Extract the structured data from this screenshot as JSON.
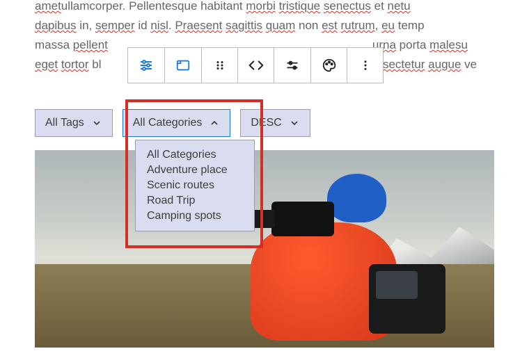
{
  "paragraph": {
    "line1a": "amet",
    "line1b": "ullamcorper",
    "line1c": ". Pellentesque habitant ",
    "line1d": "morbi",
    "line1e": " ",
    "line1f": "tristique",
    "line1g": " ",
    "line1h": "senectus",
    "line1i": " et ",
    "line1j": "netu",
    "line2a": "dapibus",
    "line2b": " in, ",
    "line2c": "semper",
    "line2d": " id ",
    "line2e": "nisl",
    "line2f": ". ",
    "line2g": "Praesent",
    "line2h": " ",
    "line2i": "sagittis",
    "line2j": " ",
    "line2k": "quam",
    "line2l": " non ",
    "line2m": "est",
    "line2n": " ",
    "line2o": "rutrum",
    "line2p": ", ",
    "line2q": "eu",
    "line2r": " temp",
    "line3a": "massa ",
    "line3b": "pellent",
    "line3c": "urna",
    "line3d": " porta ",
    "line3e": "malesu",
    "line4a": "eget",
    "line4b": " ",
    "line4c": "tortor",
    "line4d": " bl",
    "line4e": "nsectetur",
    "line4f": " ",
    "line4g": "augue",
    "line4h": " ve"
  },
  "filters": {
    "tags": {
      "label": "All Tags"
    },
    "categories": {
      "label": "All Categories",
      "options": [
        "All Categories",
        "Adventure place",
        "Scenic routes",
        "Road Trip",
        "Camping spots"
      ]
    },
    "sort": {
      "label": "DESC"
    }
  }
}
